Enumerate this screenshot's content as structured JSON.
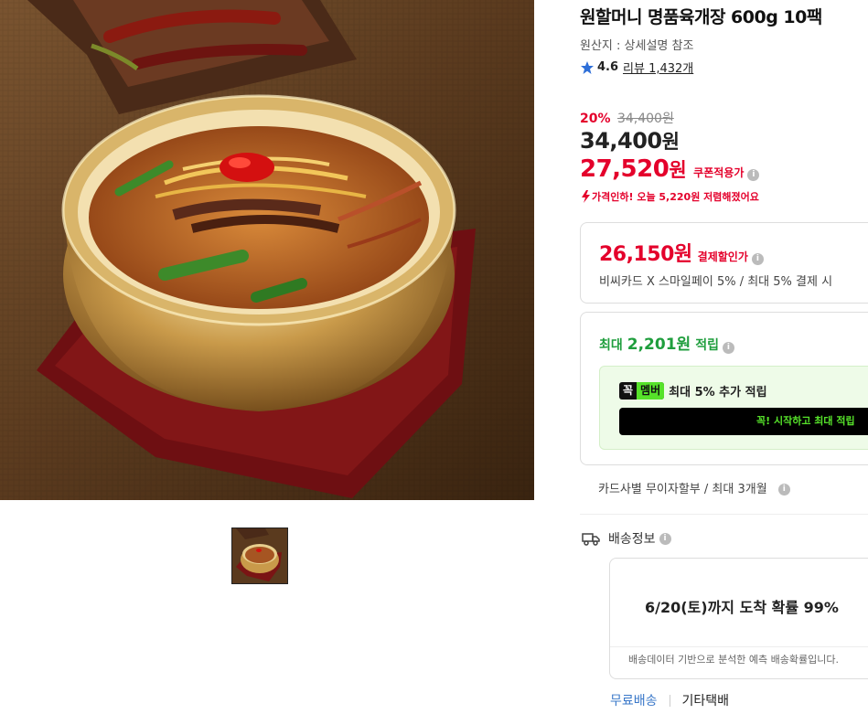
{
  "product": {
    "title": "원할머니 명품육개장 600g 10팩",
    "origin": "원산지 : 상세설명 참조",
    "rating": "4.6",
    "review_text": "리뷰 1,432개"
  },
  "price": {
    "discount_rate": "20%",
    "original_price": "34,400원",
    "sale_price_num": "34,400",
    "won": "원",
    "coupon_price_num": "27,520",
    "coupon_label": "쿠폰적용가",
    "price_drop_text": "가격인하! 오늘 5,220원 저렴해졌어요",
    "info_glyph": "i"
  },
  "card_discount": {
    "price_num": "26,150",
    "label": "결제할인가",
    "description": "비씨카드 X 스마일페이 5% / 최대 5% 결제 시"
  },
  "reward": {
    "prefix": "최대",
    "amount": "2,201원",
    "suffix": "적립",
    "member_badge_a": "꼭",
    "member_badge_b": "멤버",
    "member_text": "최대 5% 추가 적립",
    "member_cta": "꼭! 시작하고 최대 적립"
  },
  "installment": {
    "text": "카드사별 무이자할부 / 최대 3개월"
  },
  "shipping": {
    "heading": "배송정보",
    "arrival": "6/20(토)까지 도착 확률 99%",
    "note": "배송데이터 기반으로 분석한 예측 배송확률입니다.",
    "option_free": "무료배송",
    "option_other": "기타택배"
  },
  "colors": {
    "discount_red": "#e4002b",
    "reward_green": "#1f9e3d",
    "member_green": "#56e22a",
    "star_blue": "#2e6fd8",
    "link_blue": "#3a78c9"
  },
  "icons": [
    "star-icon",
    "info-icon",
    "price-drop-icon",
    "truck-icon"
  ]
}
